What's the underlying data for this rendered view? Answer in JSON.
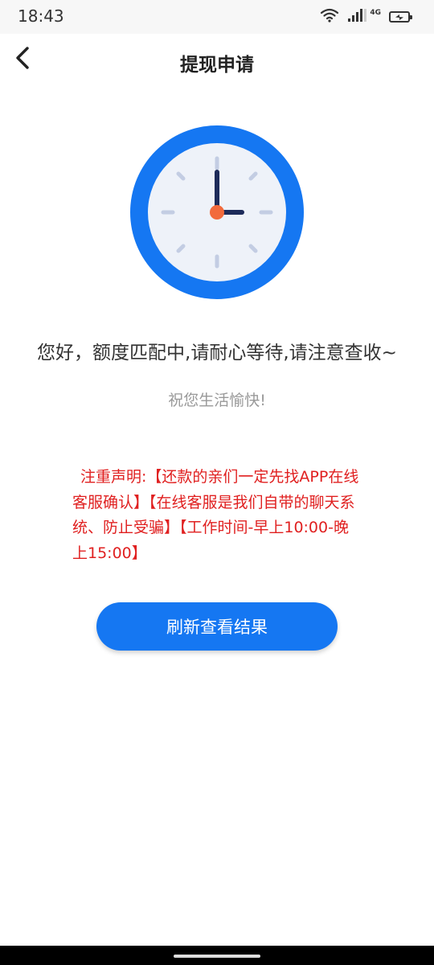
{
  "status_bar": {
    "time": "18:43",
    "network_label": "4G",
    "icons": [
      "wifi-icon",
      "signal-icon",
      "battery-charging-icon"
    ]
  },
  "nav": {
    "title": "提现申请",
    "back_icon": "chevron-left-icon"
  },
  "illustration": {
    "icon": "clock-icon",
    "colors": {
      "ring": "#1577f2",
      "face": "#eef2f9",
      "hands": "#1d2b5a",
      "center": "#f26a3c",
      "ticks": "#c3cde3"
    }
  },
  "content": {
    "main_message": "您好，额度匹配中,请耐心等待,请注意查收~",
    "sub_message": "祝您生活愉快!",
    "notice": "注重声明:【还款的亲们一定先找APP在线客服确认】【在线客服是我们自带的聊天系统、防止受骗】【工作时间-早上10:00-晚上15:00】"
  },
  "actions": {
    "refresh_label": "刷新查看结果"
  },
  "colors": {
    "accent": "#1577f2",
    "notice_text": "#e02020",
    "secondary_text": "#999999"
  }
}
